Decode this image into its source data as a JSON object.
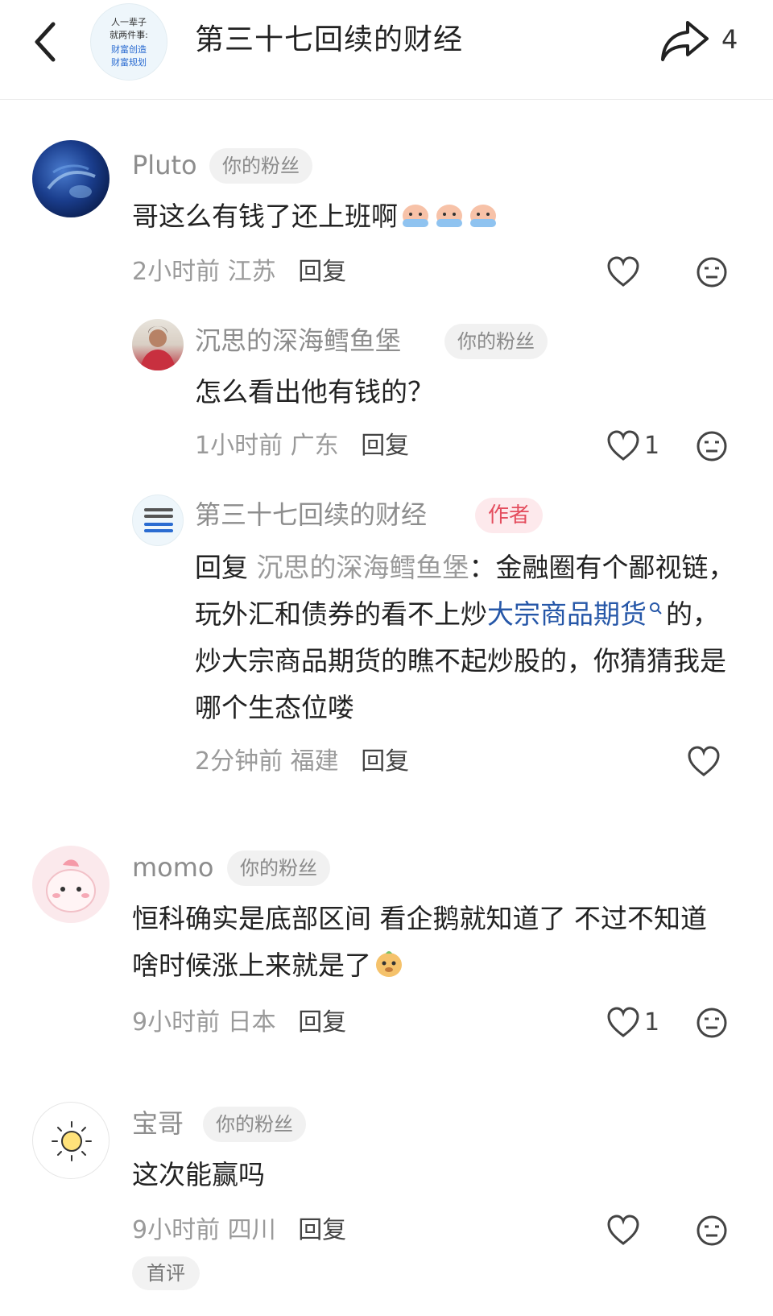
{
  "header": {
    "title": "第三十七回续的财经",
    "share_count": "4",
    "avatar_lines": [
      "人一辈子",
      "就两件事:",
      "财富创造",
      "财富规划"
    ]
  },
  "comments": [
    {
      "name": "Pluto",
      "badge": "你的粉丝",
      "text": "哥这么有钱了还上班啊",
      "time": "2小时前",
      "location": "江苏",
      "reply_label": "回复",
      "likes": "",
      "replies": [
        {
          "name": "沉思的深海鳕鱼堡",
          "badge": "你的粉丝",
          "text": "怎么看出他有钱的？",
          "time": "1小时前",
          "location": "广东",
          "reply_label": "回复",
          "likes": "1"
        },
        {
          "name": "第三十七回续的财经",
          "badge": "作者",
          "reply_prefix": "回复",
          "reply_to": "沉思的深海鳕鱼堡",
          "text_part1": "：金融圈有个鄙视链，玩外汇和债券的看不上炒",
          "link_text": "大宗商品期货",
          "text_part2": "的，炒大宗商品期货的瞧不起炒股的，你猜猜我是哪个生态位喽",
          "time": "2分钟前",
          "location": "福建",
          "reply_label": "回复"
        }
      ]
    },
    {
      "name": "momo",
      "badge": "你的粉丝",
      "text": "恒科确实是底部区间 看企鹅就知道了 不过不知道啥时候涨上来就是了",
      "time": "9小时前",
      "location": "日本",
      "reply_label": "回复",
      "likes": "1"
    },
    {
      "name": "宝哥",
      "badge": "你的粉丝",
      "text": "这次能赢吗",
      "time": "9小时前",
      "location": "四川",
      "reply_label": "回复",
      "likes": "",
      "tag": "首评"
    }
  ],
  "icons": {
    "back": "chevron-left-icon",
    "share": "share-arrow-icon",
    "like": "heart-outline-icon",
    "dislike": "neutral-face-icon",
    "search": "search-icon"
  },
  "colors": {
    "link": "#2657a8",
    "author_badge": "#e44d5e",
    "muted": "#9a9a9a"
  }
}
